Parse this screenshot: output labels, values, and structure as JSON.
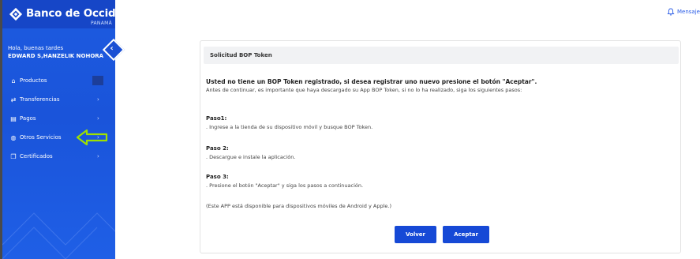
{
  "sidebar": {
    "brand": "Banco de Occidente",
    "brand_sub": "PANAMÁ",
    "greeting": "Hola, buenas tardes",
    "user_name": "EDWARD S,HANZELIK NOHORA",
    "items": [
      {
        "label": "Productos",
        "icon": "home-icon"
      },
      {
        "label": "Transferencias",
        "icon": "transfer-icon"
      },
      {
        "label": "Pagos",
        "icon": "payments-icon"
      },
      {
        "label": "Otros Servicios",
        "icon": "services-icon"
      },
      {
        "label": "Certificados",
        "icon": "certificate-icon"
      }
    ],
    "colors": {
      "bg": "#1d5be0",
      "annotation_arrow": "#9ee000"
    }
  },
  "topbar": {
    "messages_label": "Mensajes"
  },
  "card": {
    "title": "Solicitud BOP Token",
    "intro_bold": "Usted no tiene un BOP Token registrado, si desea registrar uno nuevo presione el botón \"Aceptar\".",
    "intro_text": "Antes de continuar, es importante que haya descargado su App BOP Token, si no lo ha realizado, siga los siguientes pasos:",
    "steps": [
      {
        "title": "Paso1:",
        "text": ". Ingrese a la tienda de su dispositivo móvil y busque BOP Token."
      },
      {
        "title": "Paso 2:",
        "text": ". Descargue e instale la aplicación."
      },
      {
        "title": "Paso 3:",
        "text": ". Presione el botón \"Aceptar\" y siga los pasos a continuación."
      }
    ],
    "note": "(Este APP está disponible para dispositivos móviles de Android y Apple.)",
    "back_label": "Volver",
    "accept_label": "Aceptar"
  }
}
